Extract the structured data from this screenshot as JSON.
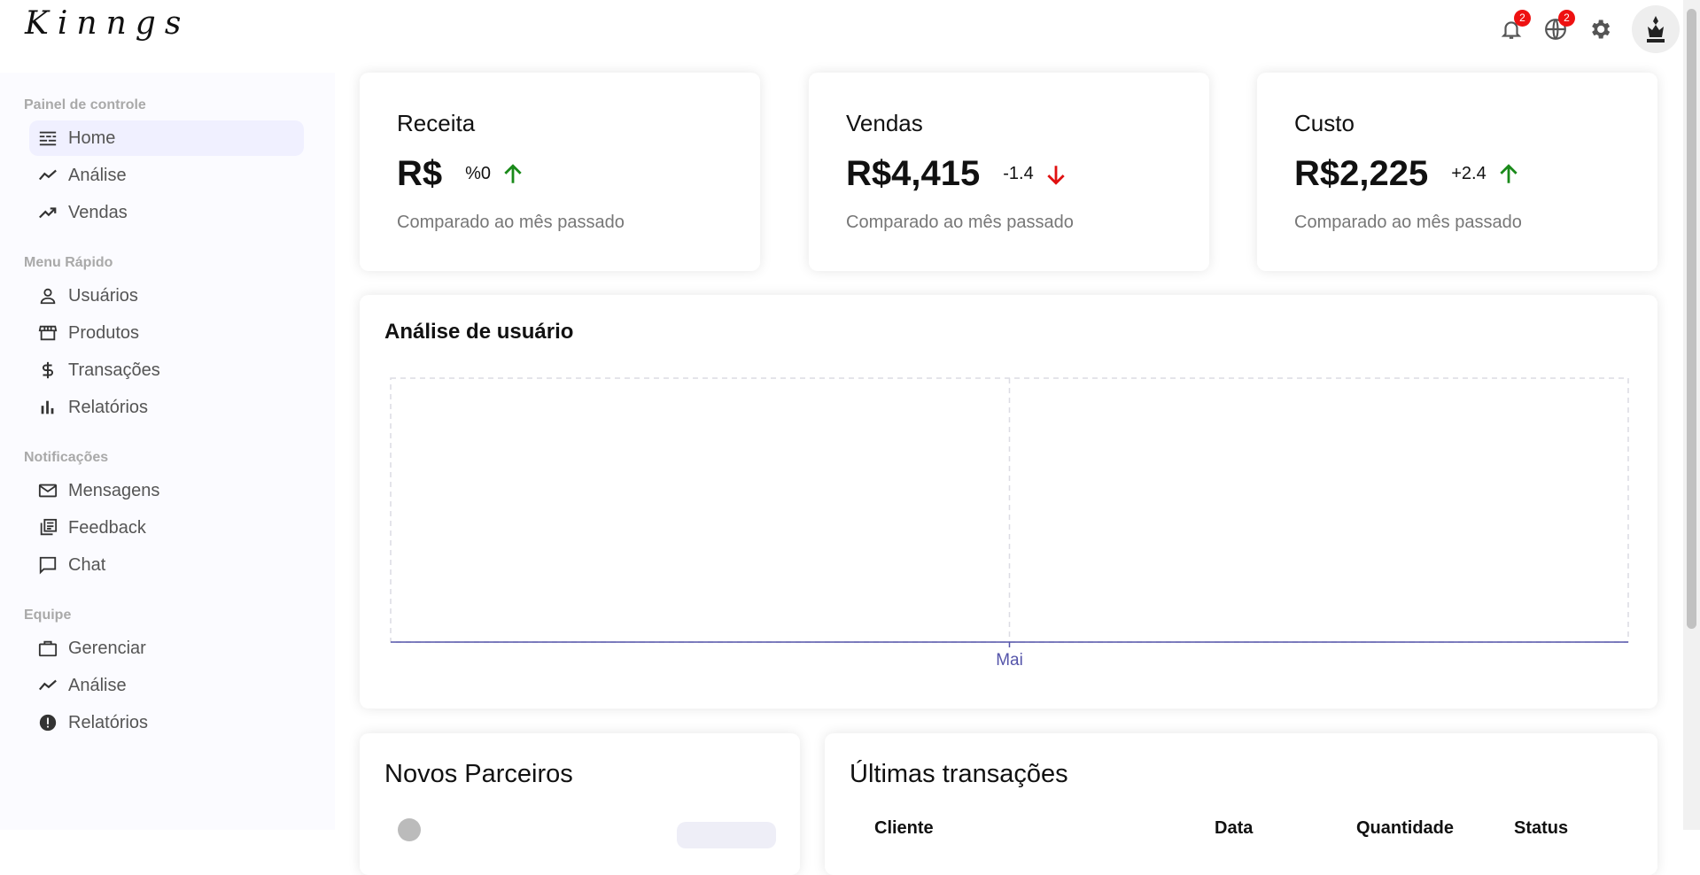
{
  "app": {
    "logo": "Kinngs"
  },
  "header": {
    "notifications_count": "2",
    "language_count": "2"
  },
  "sidebar": {
    "sections": [
      {
        "title": "Painel de controle",
        "items": [
          {
            "label": "Home",
            "icon": "dashboard-icon",
            "active": true
          },
          {
            "label": "Análise",
            "icon": "timeline-icon"
          },
          {
            "label": "Vendas",
            "icon": "trending-up-icon"
          }
        ]
      },
      {
        "title": "Menu Rápido",
        "items": [
          {
            "label": "Usuários",
            "icon": "person-icon"
          },
          {
            "label": "Produtos",
            "icon": "storefront-icon"
          },
          {
            "label": "Transações",
            "icon": "dollar-icon"
          },
          {
            "label": "Relatórios",
            "icon": "bar-chart-icon"
          }
        ]
      },
      {
        "title": "Notificações",
        "items": [
          {
            "label": "Mensagens",
            "icon": "mail-icon"
          },
          {
            "label": "Feedback",
            "icon": "library-icon"
          },
          {
            "label": "Chat",
            "icon": "chat-icon"
          }
        ]
      },
      {
        "title": "Equipe",
        "items": [
          {
            "label": "Gerenciar",
            "icon": "briefcase-icon"
          },
          {
            "label": "Análise",
            "icon": "timeline-icon"
          },
          {
            "label": "Relatórios",
            "icon": "report-icon"
          }
        ]
      }
    ]
  },
  "kpis": [
    {
      "title": "Receita",
      "value": "R$",
      "rate": "%0",
      "trend": "up",
      "subtitle": "Comparado ao mês passado"
    },
    {
      "title": "Vendas",
      "value": "R$4,415",
      "rate": "-1.4",
      "trend": "down",
      "subtitle": "Comparado ao mês passado"
    },
    {
      "title": "Custo",
      "value": "R$2,225",
      "rate": "+2.4",
      "trend": "up",
      "subtitle": "Comparado ao mês passado"
    }
  ],
  "colors": {
    "up": "#1a8a1a",
    "down": "#e01010",
    "accent": "#5555aa"
  },
  "analytics": {
    "title": "Análise de usuário",
    "chart_data": {
      "type": "line",
      "categories": [
        "Mai"
      ],
      "series": [
        {
          "values": [
            0
          ]
        }
      ],
      "grid": true
    }
  },
  "partners": {
    "title": "Novos Parceiros"
  },
  "transactions": {
    "title": "Últimas transações",
    "columns": [
      "Cliente",
      "Data",
      "Quantidade",
      "Status"
    ]
  }
}
